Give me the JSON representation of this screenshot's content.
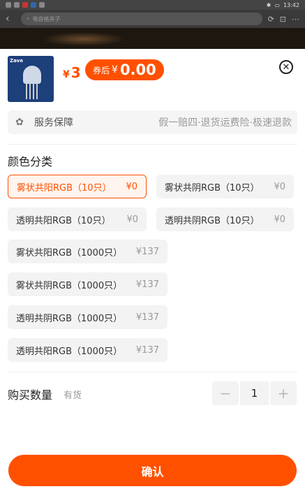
{
  "status_bar": {
    "time": "13:42"
  },
  "top_bar": {
    "search_placeholder": "电容格夹子"
  },
  "product": {
    "thumb_brand": "Zave",
    "price_cur": "¥",
    "price": "3",
    "coupon_label": "券后",
    "coupon_cur": "¥",
    "coupon_price": "0.00"
  },
  "service": {
    "label": "服务保障",
    "desc": "假一赔四·退货运费险·极速退款"
  },
  "color_section": {
    "title": "颜色分类",
    "options": [
      {
        "name": "雾状共阳RGB（10只）",
        "price": "¥0",
        "selected": true
      },
      {
        "name": "雾状共阴RGB（10只）",
        "price": "¥0",
        "selected": false
      },
      {
        "name": "透明共阳RGB（10只）",
        "price": "¥0",
        "selected": false
      },
      {
        "name": "透明共阴RGB（10只）",
        "price": "¥0",
        "selected": false
      },
      {
        "name": "雾状共阳RGB（1000只）",
        "price": "¥137",
        "selected": false
      },
      {
        "name": "雾状共阴RGB（1000只）",
        "price": "¥137",
        "selected": false
      },
      {
        "name": "透明共阴RGB（1000只）",
        "price": "¥137",
        "selected": false
      },
      {
        "name": "透明共阳RGB（1000只）",
        "price": "¥137",
        "selected": false
      }
    ]
  },
  "quantity": {
    "title": "购买数量",
    "stock": "有货",
    "value": "1",
    "minus": "−",
    "plus": "+"
  },
  "confirm_label": "确认",
  "colors": {
    "accent": "#ff5000",
    "chip_bg": "#f3f3f3"
  }
}
